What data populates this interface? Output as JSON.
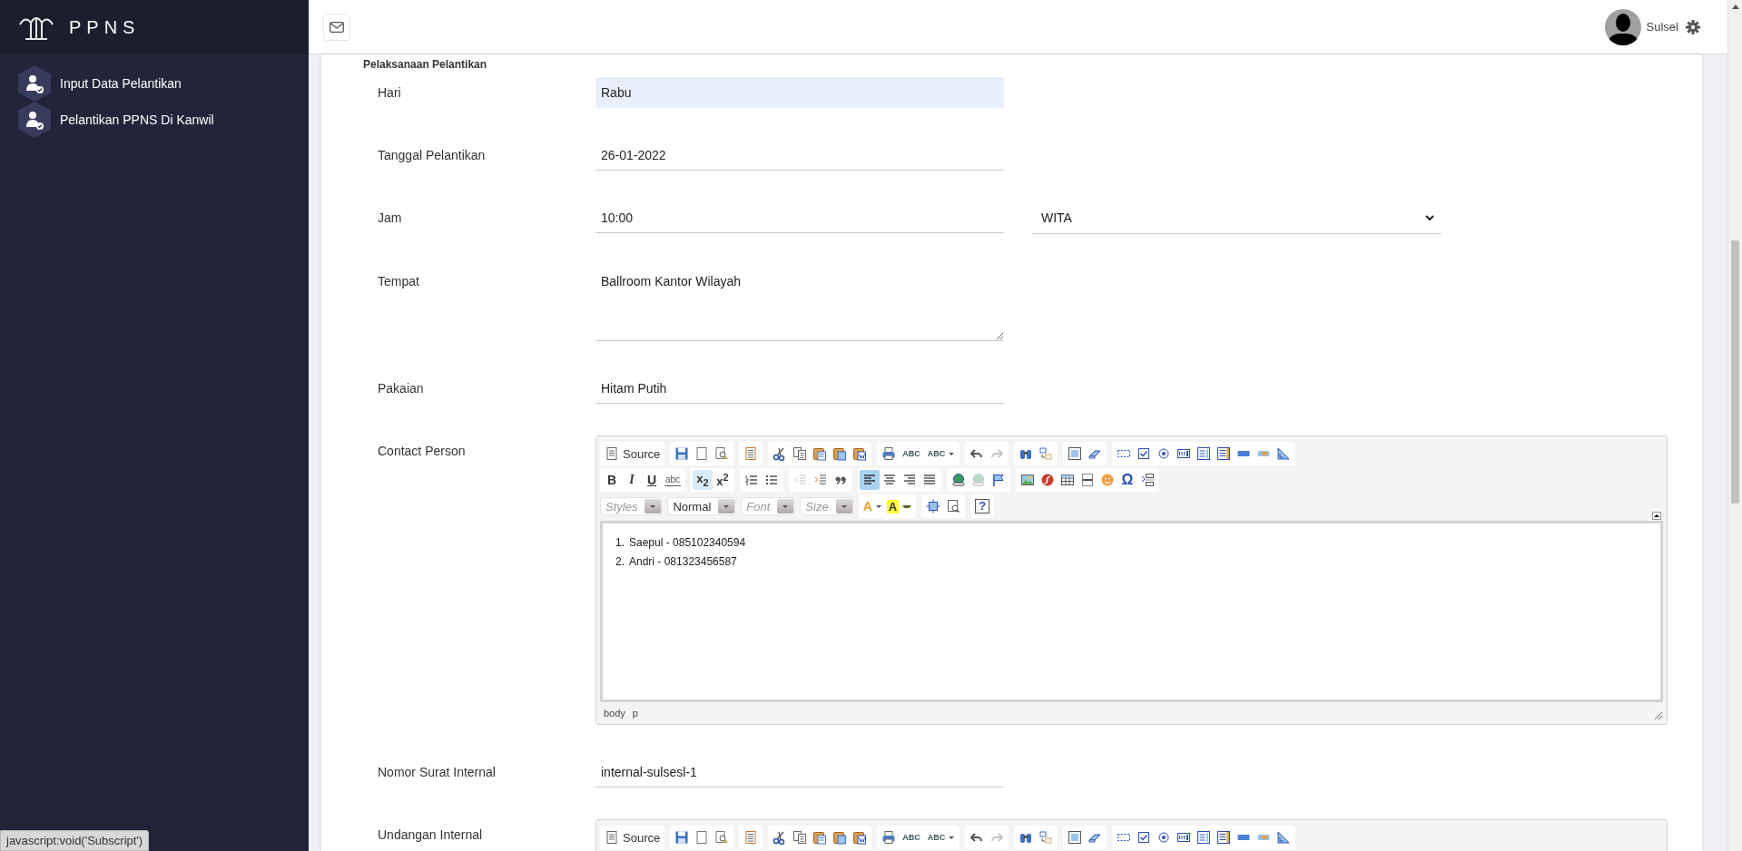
{
  "sidebar": {
    "brand": "PPNS",
    "items": [
      {
        "label": "Input Data Pelantikan"
      },
      {
        "label": "Pelantikan PPNS Di Kanwil"
      }
    ]
  },
  "topbar": {
    "user": "Sulsel"
  },
  "form": {
    "section_title": "Pelaksanaan Pelantikan",
    "rows": [
      {
        "kind": "input",
        "label": "Hari",
        "value": "Rabu",
        "autofilled": true
      },
      {
        "kind": "input",
        "label": "Tanggal Pelantikan",
        "value": "26-01-2022",
        "autofilled": false
      },
      {
        "kind": "time",
        "label": "Jam",
        "value": "10:00",
        "zone": "WITA"
      },
      {
        "kind": "textarea",
        "label": "Tempat",
        "value": "Ballroom Kantor Wilayah"
      },
      {
        "kind": "input",
        "label": "Pakaian",
        "value": "Hitam Putih",
        "autofilled": false
      },
      {
        "kind": "editor",
        "label": "Contact Person"
      },
      {
        "kind": "input",
        "label": "Nomor Surat Internal",
        "value": "internal-sulsesl-1",
        "autofilled": false
      },
      {
        "kind": "editor",
        "label": "Undangan Internal"
      }
    ]
  },
  "editors": [
    {
      "toolbar": [
        [
          [
            {
              "kind": "source",
              "label": "Source",
              "disabled": false
            }
          ],
          [
            {
              "kind": "save",
              "disabled": false
            },
            {
              "kind": "newpage",
              "disabled": false
            },
            {
              "kind": "preview",
              "disabled": false
            }
          ],
          [
            {
              "kind": "templates",
              "disabled": false
            }
          ],
          [
            {
              "kind": "cut",
              "disabled": false
            },
            {
              "kind": "copy",
              "disabled": false
            },
            {
              "kind": "paste",
              "disabled": false
            },
            {
              "kind": "pastetext",
              "disabled": false
            },
            {
              "kind": "pasteword",
              "disabled": false
            }
          ],
          [
            {
              "kind": "print",
              "disabled": false
            },
            {
              "kind": "spell",
              "label": "ABC",
              "disabled": false
            },
            {
              "kind": "spellmenu",
              "label": "ABC",
              "disabled": false
            }
          ],
          [
            {
              "kind": "undo",
              "disabled": false
            },
            {
              "kind": "redo",
              "disabled": true
            }
          ],
          [
            {
              "kind": "find",
              "disabled": false
            },
            {
              "kind": "replace",
              "disabled": false
            }
          ],
          [
            {
              "kind": "selectall",
              "disabled": false
            },
            {
              "kind": "removeformat",
              "disabled": false
            }
          ],
          [
            {
              "kind": "form",
              "disabled": false
            },
            {
              "kind": "checkbox",
              "disabled": false
            },
            {
              "kind": "radio",
              "disabled": false
            },
            {
              "kind": "textfield",
              "disabled": false
            },
            {
              "kind": "textarea",
              "disabled": false
            },
            {
              "kind": "select",
              "disabled": false
            },
            {
              "kind": "button",
              "disabled": false
            },
            {
              "kind": "imagebutton",
              "disabled": false
            },
            {
              "kind": "hidden",
              "disabled": false
            }
          ]
        ],
        [
          [
            {
              "kind": "bold",
              "label": "B",
              "disabled": false,
              "selected": false
            },
            {
              "kind": "italic",
              "label": "I",
              "disabled": false,
              "selected": false
            },
            {
              "kind": "underline",
              "label": "U",
              "disabled": false,
              "selected": false
            },
            {
              "kind": "strike",
              "label": "abc",
              "disabled": false,
              "selected": false
            }
          ],
          [
            {
              "kind": "script",
              "label": "x$_{2}$",
              "disabled": false,
              "selected": true
            },
            {
              "kind": "script",
              "label": "x$^{2}$",
              "disabled": false,
              "selected": false
            }
          ],
          [
            {
              "kind": "numlist",
              "disabled": false
            },
            {
              "kind": "bullist",
              "disabled": false
            }
          ],
          [
            {
              "kind": "outdent",
              "disabled": true
            },
            {
              "kind": "indent",
              "disabled": false
            },
            {
              "kind": "blockquote",
              "disabled": false
            }
          ],
          [
            {
              "kind": "alignleft",
              "disabled": false,
              "selected": true
            },
            {
              "kind": "aligncenter",
              "disabled": false,
              "selected": false
            },
            {
              "kind": "alignright",
              "disabled": false,
              "selected": false
            },
            {
              "kind": "justify",
              "disabled": false,
              "selected": false
            }
          ],
          [
            {
              "kind": "link",
              "disabled": false
            },
            {
              "kind": "unlink",
              "disabled": true
            },
            {
              "kind": "anchor",
              "disabled": false
            }
          ],
          [
            {
              "kind": "image",
              "disabled": false
            },
            {
              "kind": "flash",
              "disabled": false
            },
            {
              "kind": "table",
              "disabled": false
            },
            {
              "kind": "hr",
              "disabled": false
            },
            {
              "kind": "smiley",
              "disabled": false
            },
            {
              "kind": "specialchar",
              "label": "Ω",
              "disabled": false
            },
            {
              "kind": "pagebreak",
              "disabled": false
            }
          ]
        ],
        [
          [
            {
              "kind": "combo",
              "placeholder": "Styles"
            }
          ],
          [
            {
              "kind": "combo",
              "value": "Normal"
            }
          ],
          [
            {
              "kind": "combo",
              "placeholder": "Font"
            }
          ],
          [
            {
              "kind": "combo",
              "placeholder": "Size"
            }
          ],
          [
            {
              "kind": "textcolor",
              "label": "A",
              "disabled": false
            },
            {
              "kind": "bgcolor",
              "label": "A",
              "disabled": false
            }
          ],
          [
            {
              "kind": "maximize",
              "disabled": false
            },
            {
              "kind": "showblocks",
              "disabled": false
            }
          ],
          [
            {
              "kind": "about",
              "label": "?",
              "disabled": false
            }
          ]
        ]
      ],
      "content": [
        {
          "marker": "1.",
          "text": "Saepul - 085102340594"
        },
        {
          "marker": "2.",
          "text": "Andri - 081323456587"
        }
      ],
      "path": [
        "body",
        "p"
      ]
    },
    {
      "toolbar": [
        [
          [
            {
              "kind": "source",
              "label": "Source",
              "disabled": false
            }
          ],
          [
            {
              "kind": "save",
              "disabled": false
            },
            {
              "kind": "newpage",
              "disabled": false
            },
            {
              "kind": "preview",
              "disabled": false
            }
          ],
          [
            {
              "kind": "templates",
              "disabled": false
            }
          ],
          [
            {
              "kind": "cut",
              "disabled": false
            },
            {
              "kind": "copy",
              "disabled": false
            },
            {
              "kind": "paste",
              "disabled": false
            },
            {
              "kind": "pastetext",
              "disabled": false
            },
            {
              "kind": "pasteword",
              "disabled": false
            }
          ],
          [
            {
              "kind": "print",
              "disabled": false
            },
            {
              "kind": "spell",
              "label": "ABC",
              "disabled": false
            },
            {
              "kind": "spellmenu",
              "label": "ABC",
              "disabled": false
            }
          ],
          [
            {
              "kind": "undo",
              "disabled": false
            },
            {
              "kind": "redo",
              "disabled": true
            }
          ],
          [
            {
              "kind": "find",
              "disabled": false
            },
            {
              "kind": "replace",
              "disabled": false
            }
          ],
          [
            {
              "kind": "selectall",
              "disabled": false
            },
            {
              "kind": "removeformat",
              "disabled": false
            }
          ],
          [
            {
              "kind": "form",
              "disabled": false
            },
            {
              "kind": "checkbox",
              "disabled": false
            },
            {
              "kind": "radio",
              "disabled": false
            },
            {
              "kind": "textfield",
              "disabled": false
            },
            {
              "kind": "textarea",
              "disabled": false
            },
            {
              "kind": "select",
              "disabled": false
            },
            {
              "kind": "button",
              "disabled": false
            },
            {
              "kind": "imagebutton",
              "disabled": false
            },
            {
              "kind": "hidden",
              "disabled": false
            }
          ]
        ]
      ]
    }
  ],
  "status_tooltip": "javascript:void('Subscript')"
}
